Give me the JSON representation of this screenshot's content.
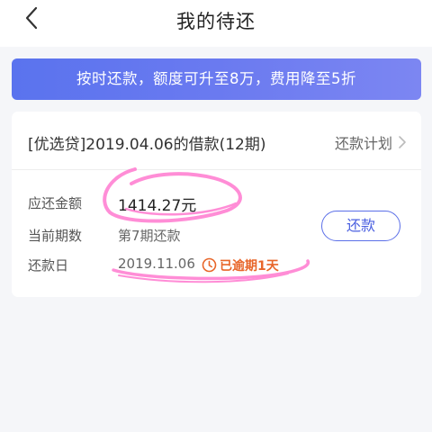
{
  "nav": {
    "title": "我的待还",
    "back_icon": "chevron-left-icon"
  },
  "banner": {
    "text": "按时还款，额度可升至8万，费用降至5折"
  },
  "loan_card": {
    "title": "[优选贷]2019.04.06的借款(12期)",
    "plan_link": "还款计划",
    "plan_chevron_icon": "chevron-right-icon",
    "rows": {
      "amount_label": "应还金额",
      "amount_value": "1414.27元",
      "period_label": "当前期数",
      "period_value": "第7期还款",
      "date_label": "还款日",
      "date_value": "2019.11.06",
      "overdue_text": "已逾期1天"
    },
    "repay_button": "还款"
  },
  "colors": {
    "accent": "#5b6fe8",
    "overdue": "#e8662a",
    "highlighter": "#ff6ec7"
  }
}
